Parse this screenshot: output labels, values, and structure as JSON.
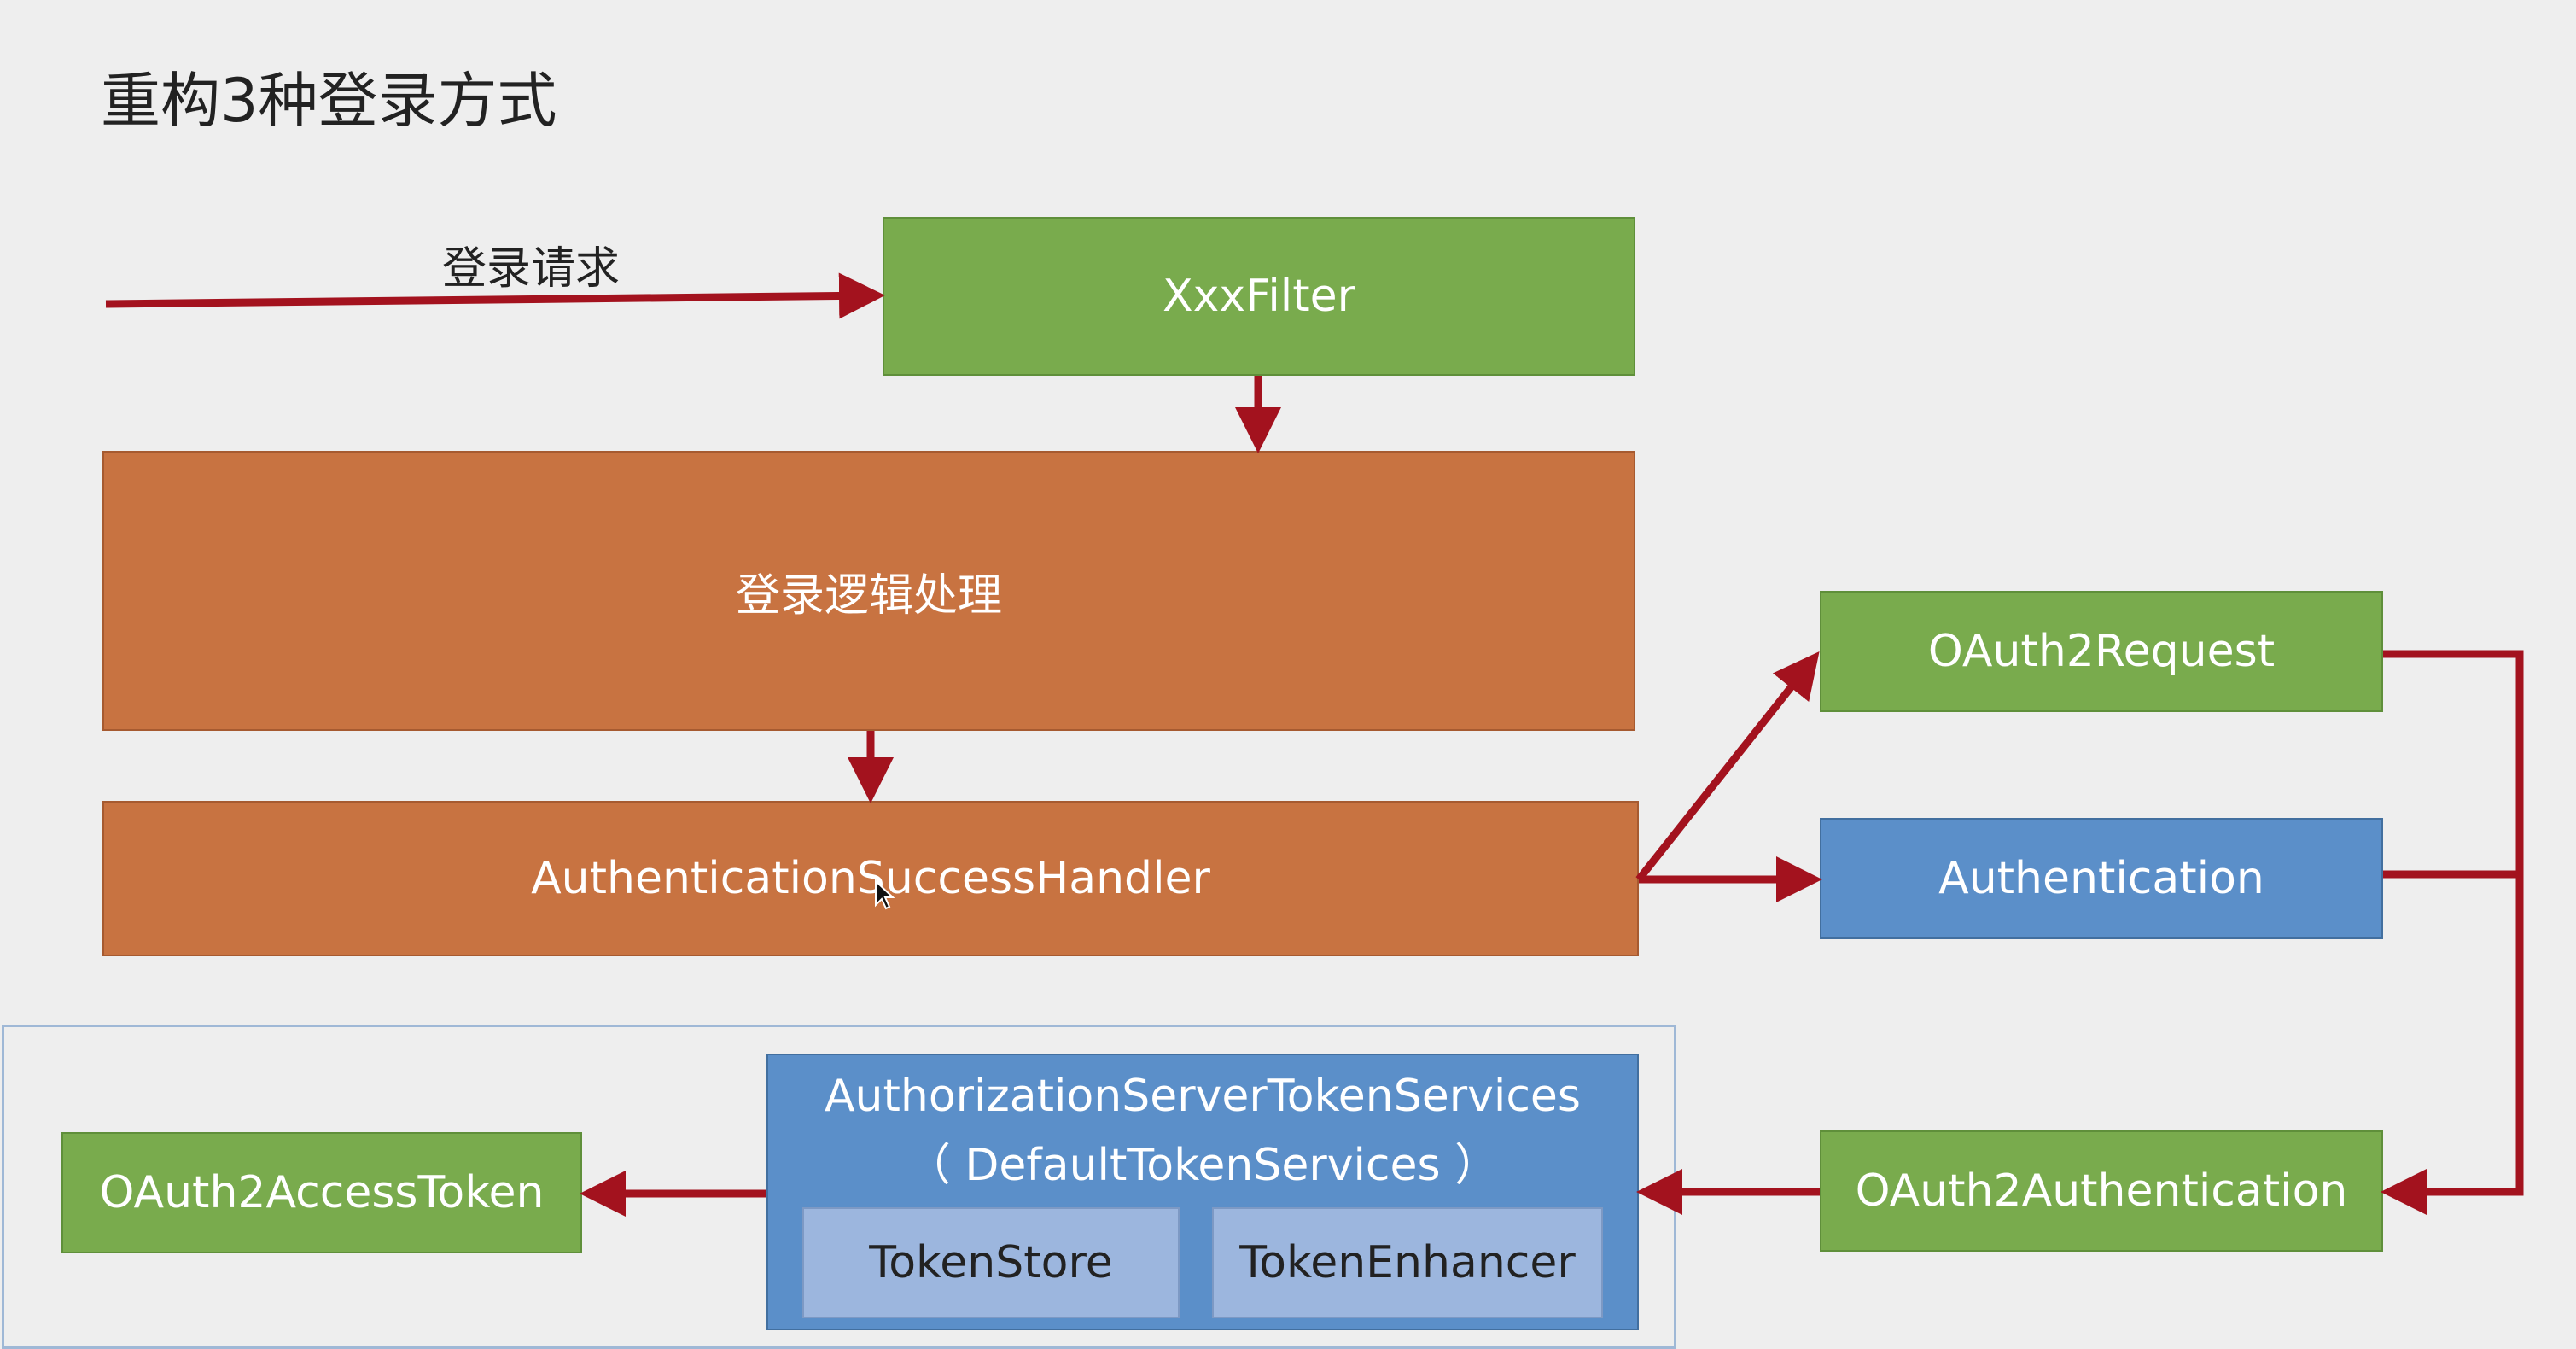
{
  "title": "重构3种登录方式",
  "edge_labels": {
    "login_request": "登录请求"
  },
  "nodes": {
    "xxx_filter": "XxxFilter",
    "login_logic": "登录逻辑处理",
    "success_handler": "AuthenticationSuccessHandler",
    "oauth2_request": "OAuth2Request",
    "authentication": "Authentication",
    "oauth2_authentication": "OAuth2Authentication",
    "token_services_line1": "AuthorizationServerTokenServices",
    "token_services_line2": "（ DefaultTokenServices ）",
    "token_store": "TokenStore",
    "token_enhancer": "TokenEnhancer",
    "access_token": "OAuth2AccessToken"
  },
  "colors": {
    "green": "#79ab4d",
    "orange": "#c87341",
    "blue": "#5b8fc9",
    "light_blue": "#9cb6de",
    "arrow": "#a3121e",
    "background": "#eeeeee"
  }
}
